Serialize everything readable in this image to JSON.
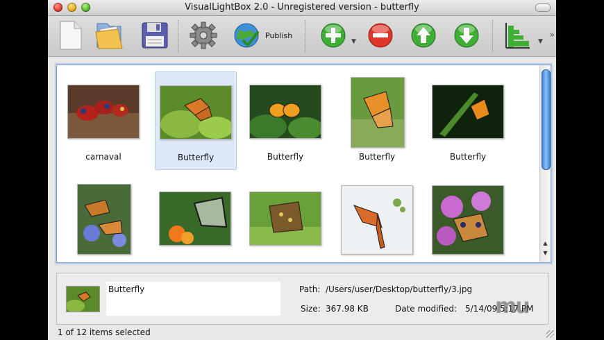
{
  "window": {
    "title": "VisualLightBox 2.0 - Unregistered version - butterfly"
  },
  "toolbar": {
    "items": [
      "new-document-icon",
      "open-folder-icon",
      "save-floppy-icon",
      "settings-gear-icon",
      "publish-globe-icon",
      "add-icon",
      "remove-icon",
      "move-up-icon",
      "move-down-icon",
      "chart-icon"
    ],
    "publish_label": "Publish"
  },
  "gallery": {
    "items": [
      {
        "label": "carnaval",
        "selected": false
      },
      {
        "label": "Butterfly",
        "selected": true
      },
      {
        "label": "Butterfly",
        "selected": false
      },
      {
        "label": "Butterfly",
        "selected": false
      },
      {
        "label": "Butterfly",
        "selected": false
      },
      {
        "label": "",
        "selected": false
      },
      {
        "label": "",
        "selected": false
      },
      {
        "label": "",
        "selected": false
      },
      {
        "label": "",
        "selected": false
      },
      {
        "label": "",
        "selected": false
      }
    ]
  },
  "info": {
    "name": "Butterfly",
    "path_label": "Path:",
    "path_value": "/Users/user/Desktop/butterfly/3.jpg",
    "size_label": "Size:",
    "size_value": "367.98 KB",
    "date_label": "Date modified:",
    "date_value": "5/14/09 5:17 PM"
  },
  "status": {
    "text": "1 of 12 items selected"
  },
  "watermark": "mu"
}
